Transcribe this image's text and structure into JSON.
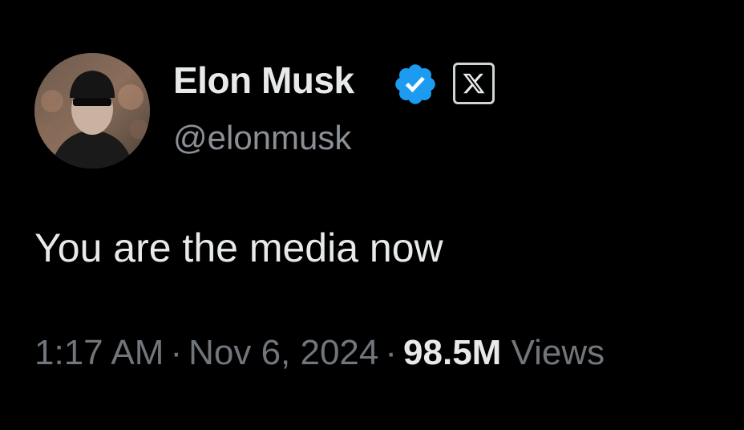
{
  "tweet": {
    "display_name": "Elon Musk",
    "handle": "@elonmusk",
    "text": "You are the media now",
    "time": "1:17 AM",
    "separator": "·",
    "date": "Nov 6, 2024",
    "views_count": "98.5M",
    "views_label": "Views"
  },
  "icons": {
    "verified": "verified-badge-icon",
    "affiliate": "x-logo-icon"
  },
  "colors": {
    "background": "#000000",
    "verified_blue": "#1d9bf0",
    "secondary_text": "#71767b"
  }
}
